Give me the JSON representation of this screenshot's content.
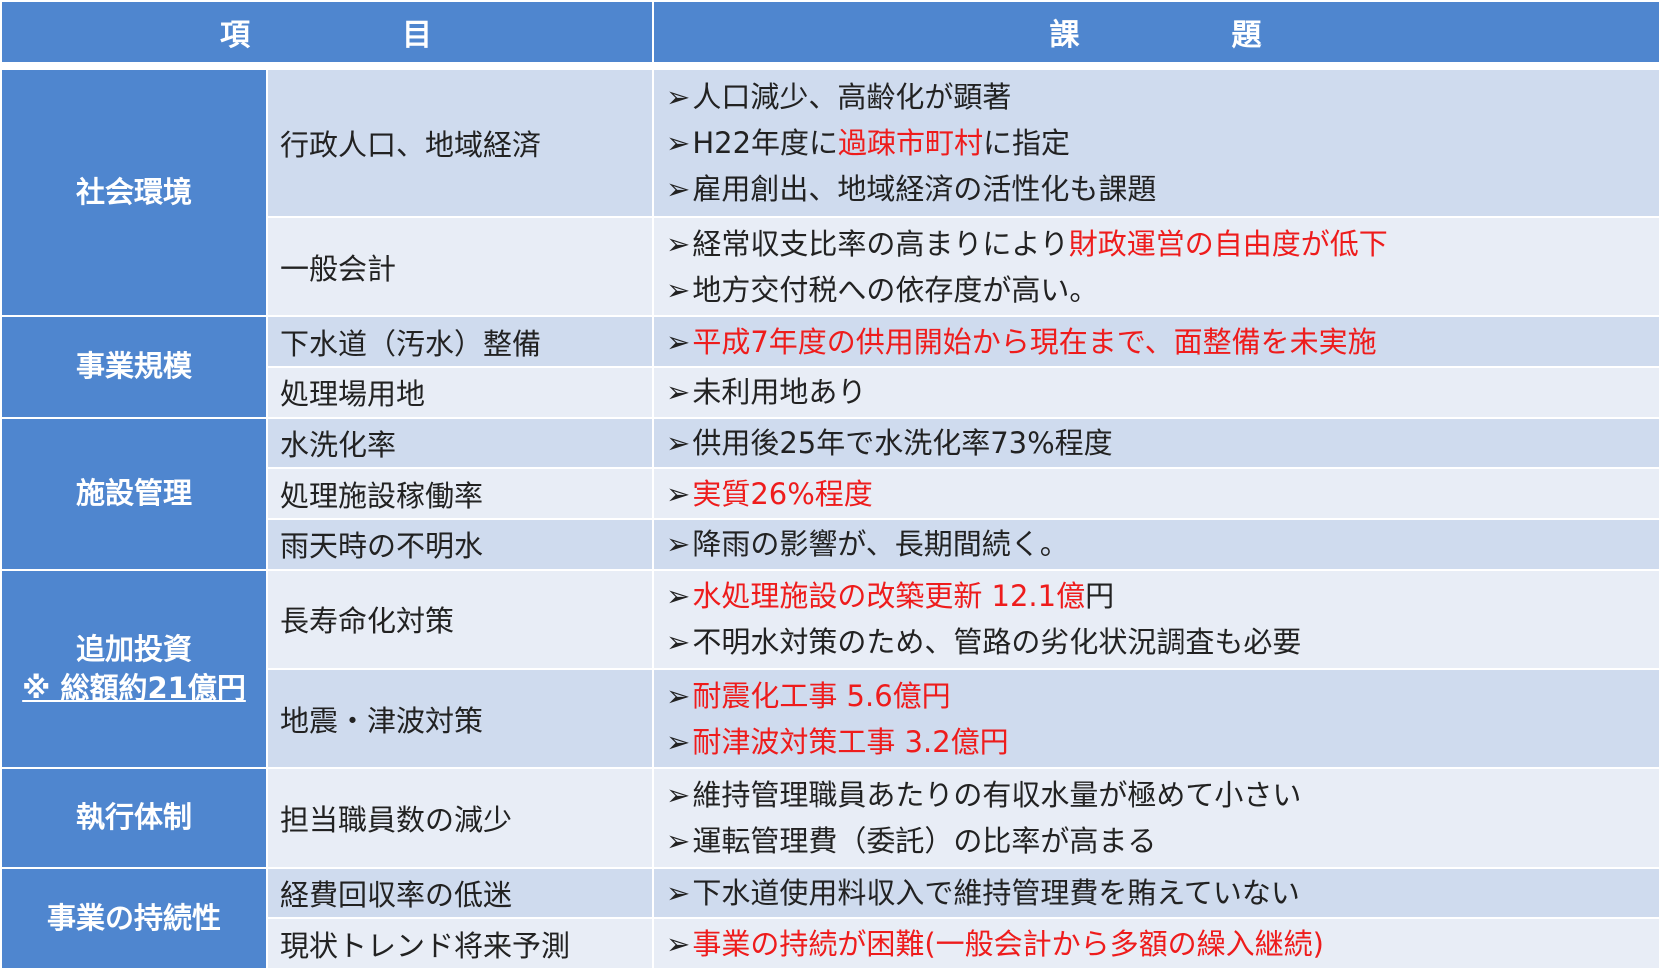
{
  "header": {
    "col1": "項　　　目",
    "col1_a": "項",
    "col1_b": "目",
    "col2_a": "課",
    "col2_b": "題"
  },
  "arrow_glyph": "➢",
  "colors": {
    "header_bg": "#4f86cf",
    "row_dark": "#cfdbee",
    "row_light": "#e8edf6",
    "highlight": "#ee1c1c",
    "text": "#222222"
  },
  "sections": [
    {
      "category": "社会環境",
      "rows": [
        {
          "item": "行政人口、地域経済",
          "issues": [
            {
              "parts": [
                {
                  "text": "人口減少、高齢化が顕著",
                  "red": false
                }
              ]
            },
            {
              "parts": [
                {
                  "text": "H22年度に",
                  "red": false
                },
                {
                  "text": "過疎市町村",
                  "red": true
                },
                {
                  "text": "に指定",
                  "red": false
                }
              ]
            },
            {
              "parts": [
                {
                  "text": "雇用創出、地域経済の活性化も課題",
                  "red": false
                }
              ]
            }
          ]
        },
        {
          "item": "一般会計",
          "issues": [
            {
              "parts": [
                {
                  "text": "経常収支比率の高まりにより",
                  "red": false
                },
                {
                  "text": "財政運営の自由度が低下",
                  "red": true
                }
              ]
            },
            {
              "parts": [
                {
                  "text": "地方交付税への依存度が高い。",
                  "red": false
                }
              ]
            }
          ]
        }
      ]
    },
    {
      "category": "事業規模",
      "rows": [
        {
          "item": "下水道（汚水）整備",
          "issues": [
            {
              "parts": [
                {
                  "text": "平成7年度の供用開始から現在まで、面整備を未実施",
                  "red": true
                }
              ]
            }
          ]
        },
        {
          "item": "処理場用地",
          "issues": [
            {
              "parts": [
                {
                  "text": "未利用地あり",
                  "red": false
                }
              ]
            }
          ]
        }
      ]
    },
    {
      "category": "施設管理",
      "rows": [
        {
          "item": "水洗化率",
          "issues": [
            {
              "parts": [
                {
                  "text": "供用後25年で水洗化率73%程度",
                  "red": false
                }
              ]
            }
          ]
        },
        {
          "item": "処理施設稼働率",
          "issues": [
            {
              "parts": [
                {
                  "text": "実質26%程度",
                  "red": true
                }
              ]
            }
          ]
        },
        {
          "item": "雨天時の不明水",
          "issues": [
            {
              "parts": [
                {
                  "text": "降雨の影響が、長期間続く。",
                  "red": false
                }
              ]
            }
          ]
        }
      ]
    },
    {
      "category": "追加投資",
      "category_sub": "※ 総額約21億円",
      "rows": [
        {
          "item": "長寿命化対策",
          "issues": [
            {
              "parts": [
                {
                  "text": "水処理施設の改築更新 12.1億",
                  "red": true
                },
                {
                  "text": "円",
                  "red": false
                }
              ]
            },
            {
              "parts": [
                {
                  "text": "不明水対策のため、管路の劣化状況調査も必要",
                  "red": false
                }
              ]
            }
          ]
        },
        {
          "item": "地震・津波対策",
          "issues": [
            {
              "parts": [
                {
                  "text": "耐震化工事 5.6億円",
                  "red": true
                }
              ]
            },
            {
              "parts": [
                {
                  "text": "耐津波対策工事 3.2億円",
                  "red": true
                }
              ]
            }
          ]
        }
      ]
    },
    {
      "category": "執行体制",
      "rows": [
        {
          "item": "担当職員数の減少",
          "issues": [
            {
              "parts": [
                {
                  "text": "維持管理職員あたりの有収水量が極めて小さい",
                  "red": false
                }
              ]
            },
            {
              "parts": [
                {
                  "text": "運転管理費（委託）の比率が高まる",
                  "red": false
                }
              ]
            }
          ]
        }
      ]
    },
    {
      "category": "事業の持続性",
      "rows": [
        {
          "item": "経費回収率の低迷",
          "issues": [
            {
              "parts": [
                {
                  "text": "下水道使用料収入で維持管理費を賄えていない",
                  "red": false
                }
              ]
            }
          ]
        },
        {
          "item": "現状トレンド将来予測",
          "issues": [
            {
              "parts": [
                {
                  "text": "事業の持続が困難(一般会計から多額の繰入継続)",
                  "red": true
                }
              ]
            }
          ]
        }
      ]
    }
  ]
}
